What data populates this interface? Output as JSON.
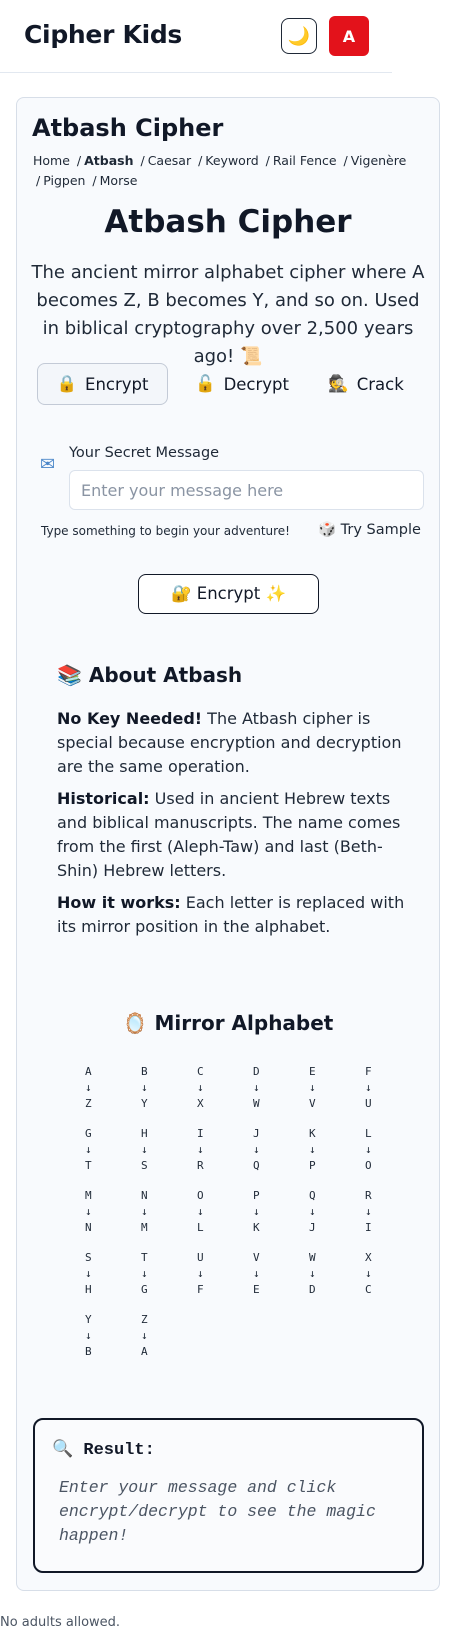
{
  "header": {
    "brand": "Cipher Kids",
    "theme_icon": "🌙",
    "font_button": "A"
  },
  "page": {
    "title": "Atbash Cipher",
    "breadcrumbs": [
      "Home",
      "Atbash",
      "Caesar",
      "Keyword",
      "Rail Fence",
      "Vigenère",
      "Pigpen",
      "Morse"
    ],
    "current_breadcrumb": "Atbash"
  },
  "hero": {
    "title": "Atbash Cipher",
    "description": "The ancient mirror alphabet cipher where A becomes Z, B becomes Y, and so on. Used in biblical cryptography over 2,500 years ago! 📜"
  },
  "modes": [
    {
      "icon": "🔒",
      "label": "Encrypt",
      "active": true
    },
    {
      "icon": "🔓",
      "label": "Decrypt",
      "active": false
    },
    {
      "icon": "🕵️",
      "label": "Crack",
      "active": false
    }
  ],
  "input": {
    "label": "Your Secret Message",
    "placeholder": "Enter your message here",
    "value": "",
    "hint": "Type something to begin your adventure!",
    "sample_button": "🎲 Try Sample"
  },
  "action_button": {
    "label": "🔐 Encrypt ✨"
  },
  "about": {
    "title": "📚 About Atbash",
    "paragraphs": [
      {
        "bold": "No Key Needed!",
        "text": " The Atbash cipher is special because encryption and decryption are the same operation."
      },
      {
        "bold": "Historical:",
        "text": " Used in ancient Hebrew texts and biblical manuscripts. The name comes from the first (Aleph-Taw) and last (Beth-Shin) Hebrew letters."
      },
      {
        "bold": "How it works:",
        "text": " Each letter is replaced with its mirror position in the alphabet."
      }
    ]
  },
  "mirror": {
    "title": "🪞 Mirror Alphabet",
    "arrow": "↓",
    "pairs": [
      [
        "A",
        "Z"
      ],
      [
        "B",
        "Y"
      ],
      [
        "C",
        "X"
      ],
      [
        "D",
        "W"
      ],
      [
        "E",
        "V"
      ],
      [
        "F",
        "U"
      ],
      [
        "G",
        "T"
      ],
      [
        "H",
        "S"
      ],
      [
        "I",
        "R"
      ],
      [
        "J",
        "Q"
      ],
      [
        "K",
        "P"
      ],
      [
        "L",
        "O"
      ],
      [
        "M",
        "N"
      ],
      [
        "N",
        "M"
      ],
      [
        "O",
        "L"
      ],
      [
        "P",
        "K"
      ],
      [
        "Q",
        "J"
      ],
      [
        "R",
        "I"
      ],
      [
        "S",
        "H"
      ],
      [
        "T",
        "G"
      ],
      [
        "U",
        "F"
      ],
      [
        "V",
        "E"
      ],
      [
        "W",
        "D"
      ],
      [
        "X",
        "C"
      ],
      [
        "Y",
        "B"
      ],
      [
        "Z",
        "A"
      ]
    ]
  },
  "result": {
    "title": "🔍 Result:",
    "placeholder_text": "Enter your message and click encrypt/decrypt to see the magic happen!"
  },
  "footer": {
    "text": "No adults allowed."
  },
  "colors": {
    "accent_red": "#e3121b",
    "text_dark": "#111827",
    "card_bg": "#f8fafd"
  }
}
